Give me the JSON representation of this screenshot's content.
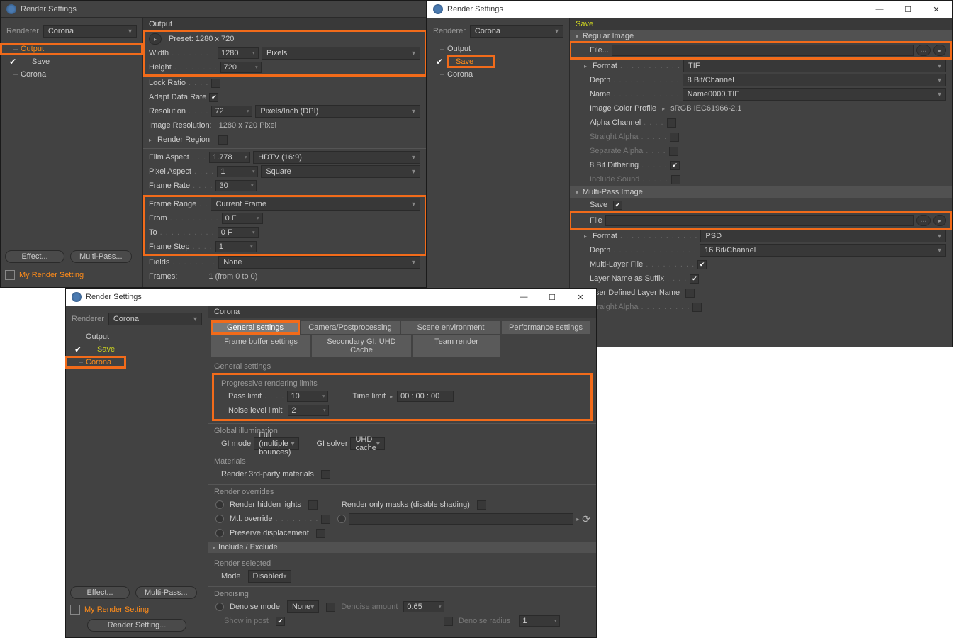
{
  "app_title": "Render Settings",
  "renderer_label": "Renderer",
  "renderer_value": "Corona",
  "tree": {
    "output": "Output",
    "save": "Save",
    "corona": "Corona"
  },
  "btn": {
    "effect": "Effect...",
    "multipass": "Multi-Pass...",
    "render_setting": "Render Setting..."
  },
  "my_render_setting": "My Render Setting",
  "w1": {
    "title": "Output",
    "preset": "Preset: 1280 x 720",
    "width_lbl": "Width",
    "width_val": "1280",
    "width_unit": "Pixels",
    "height_lbl": "Height",
    "height_val": "720",
    "lock_ratio": "Lock Ratio",
    "adapt": "Adapt Data Rate",
    "res_lbl": "Resolution",
    "res_val": "72",
    "res_unit": "Pixels/Inch (DPI)",
    "imgres_lbl": "Image Resolution:",
    "imgres_val": "1280 x 720 Pixel",
    "region": "Render Region",
    "film_lbl": "Film Aspect",
    "film_val": "1.778",
    "film_unit": "HDTV (16:9)",
    "pixel_lbl": "Pixel Aspect",
    "pixel_val": "1",
    "pixel_unit": "Square",
    "framerate_lbl": "Frame Rate",
    "framerate_val": "30",
    "framerange_lbl": "Frame Range",
    "framerange_val": "Current Frame",
    "from_lbl": "From",
    "from_val": "0 F",
    "to_lbl": "To",
    "to_val": "0 F",
    "step_lbl": "Frame Step",
    "step_val": "1",
    "fields_lbl": "Fields",
    "fields_val": "None",
    "frames_lbl": "Frames:",
    "frames_val": "1 (from 0 to 0)"
  },
  "w2": {
    "title": "Save",
    "regular": "Regular Image",
    "save_lbl": "Save",
    "file_lbl": "File...",
    "format_lbl": "Format",
    "format_val": "TIF",
    "depth_lbl": "Depth",
    "depth_val": "8 Bit/Channel",
    "name_lbl": "Name",
    "name_val": "Name0000.TIF",
    "colorprof_lbl": "Image Color Profile",
    "colorprof_val": "sRGB IEC61966-2.1",
    "alpha_lbl": "Alpha Channel",
    "straight_lbl": "Straight Alpha",
    "separate_lbl": "Separate Alpha",
    "dither_lbl": "8 Bit Dithering",
    "sound_lbl": "Include Sound",
    "multipass_sec": "Multi-Pass Image",
    "mp_save": "Save",
    "mp_file": "File",
    "mp_format_lbl": "Format",
    "mp_format_val": "PSD",
    "mp_depth_lbl": "Depth",
    "mp_depth_val": "16 Bit/Channel",
    "mp_multilayer": "Multi-Layer File",
    "mp_suffix": "Layer Name as Suffix",
    "mp_userlayer": "User Defined Layer Name",
    "mp_straight": "Straight Alpha"
  },
  "w3": {
    "title": "Corona",
    "tabs": {
      "general": "General settings",
      "camera": "Camera/Postprocessing",
      "scene": "Scene environment",
      "perf": "Performance settings",
      "fb": "Frame buffer settings",
      "gi2": "Secondary GI: UHD Cache",
      "team": "Team render"
    },
    "sec_general": "General settings",
    "prog_limits": "Progressive rendering limits",
    "pass_lbl": "Pass limit",
    "pass_val": "10",
    "time_lbl": "Time limit",
    "time_val": "00 : 00 : 00",
    "noise_lbl": "Noise level limit",
    "noise_val": "2",
    "gi": "Global illumination",
    "gi_mode_lbl": "GI mode",
    "gi_mode_val": "Full (multiple bounces)",
    "gi_solver_lbl": "GI solver",
    "gi_solver_val": "UHD cache",
    "materials": "Materials",
    "render3rd": "Render 3rd-party materials",
    "overrides": "Render overrides",
    "hidden": "Render hidden lights",
    "masks": "Render only masks (disable shading)",
    "mtl": "Mtl. override",
    "preserve": "Preserve displacement",
    "include": "Include / Exclude",
    "selected": "Render selected",
    "mode_lbl": "Mode",
    "mode_val": "Disabled",
    "denoise": "Denoising",
    "denoise_mode_lbl": "Denoise mode",
    "denoise_mode_val": "None",
    "denoise_amt_lbl": "Denoise amount",
    "denoise_amt_val": "0.65",
    "show_post": "Show in post",
    "denoise_radius_lbl": "Denoise radius",
    "denoise_radius_val": "1"
  }
}
